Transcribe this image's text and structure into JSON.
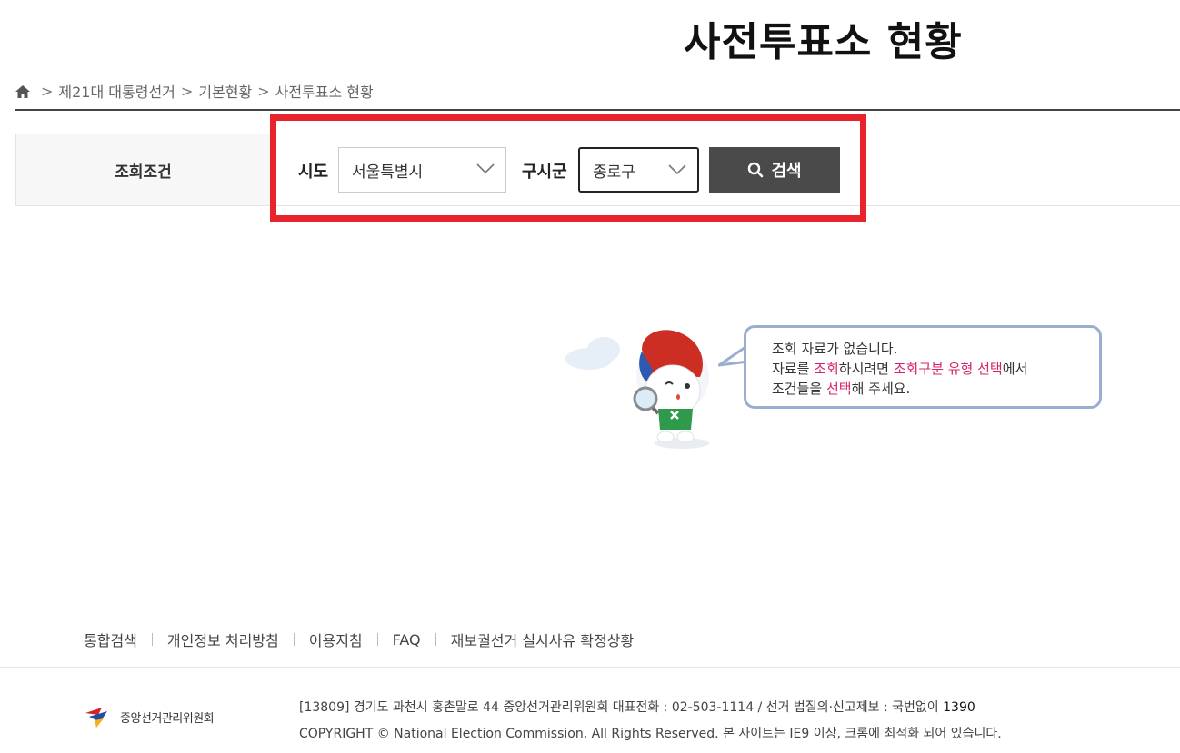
{
  "page": {
    "title": "사전투표소 현황"
  },
  "breadcrumb": {
    "icon": "home-icon",
    "separator": ">",
    "items": [
      "제21대 대통령선거",
      "기본현황",
      "사전투표소 현황"
    ]
  },
  "search": {
    "label": "조회조건",
    "sido": {
      "label": "시도",
      "value": "서울특별시"
    },
    "gusigun": {
      "label": "구시군",
      "value": "종로구"
    },
    "button": {
      "label": "검색",
      "icon": "search-icon"
    }
  },
  "empty_state": {
    "line1": "조회 자료가 없습니다.",
    "line2": {
      "p1": "자료를 ",
      "h1": "조회",
      "p2": "하시려면 ",
      "h2": "조회구분 유형 선택",
      "p3": "에서"
    },
    "line3": {
      "p1": "조건들을 ",
      "h1": "선택",
      "p2": "해 주세요."
    }
  },
  "footer": {
    "links": [
      "통합검색",
      "개인정보 처리방침",
      "이용지침",
      "FAQ",
      "재보궐선거 실시사유 확정상황"
    ],
    "logo_text": "중앙선거관리위원회",
    "address": "[13809] 경기도 과천시 홍촌말로 44 중앙선거관리위원회 대표전화 : 02-503-1114 / 선거 법질의·신고제보 : 국번없이 ",
    "hotline": "1390",
    "copyright": "COPYRIGHT © National Election Commission, All Rights Reserved. 본 사이트는 IE9 이상, 크롬에 최적화 되어 있습니다."
  },
  "colors": {
    "highlight_border": "#e8232b",
    "button_bg": "#4a4a4a",
    "accent_text": "#d6246c",
    "bubble_border": "#9aaed0"
  }
}
